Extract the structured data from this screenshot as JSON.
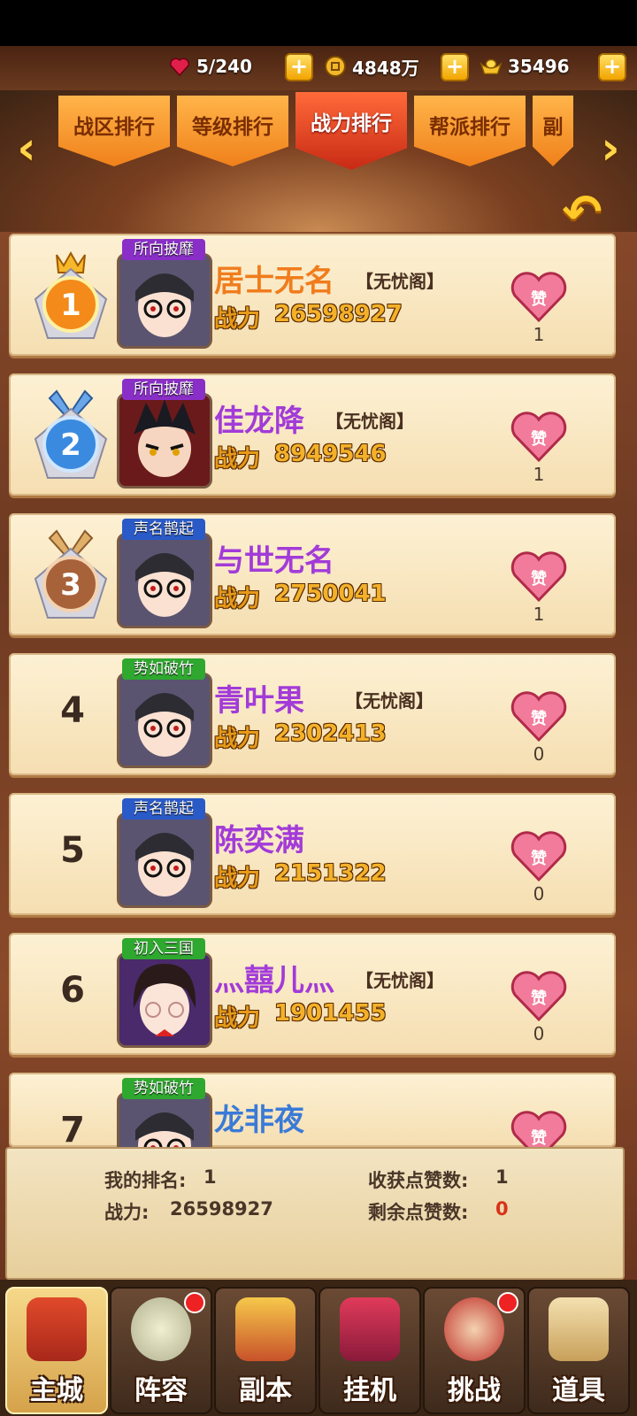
{
  "resources": {
    "stamina": "5/240",
    "coins": "4848万",
    "ingots": "35496"
  },
  "tabs": [
    {
      "label": "战区排行",
      "active": false
    },
    {
      "label": "等级排行",
      "active": false
    },
    {
      "label": "战力排行",
      "active": true
    },
    {
      "label": "帮派排行",
      "active": false
    },
    {
      "label": "副",
      "active": false
    }
  ],
  "power_label": "战力",
  "rankings": [
    {
      "rank": "1",
      "title": "所向披靡",
      "name": "居士无名",
      "guild": "【无忧阁】",
      "power": "26598927",
      "likes": "1",
      "name_color": "#f07c1c",
      "title_color": "#8a2ec8"
    },
    {
      "rank": "2",
      "title": "所向披靡",
      "name": "佳龙降",
      "guild": "【无忧阁】",
      "power": "8949546",
      "likes": "1",
      "name_color": "#a23bd8",
      "title_color": "#8a2ec8"
    },
    {
      "rank": "3",
      "title": "声名鹊起",
      "name": "与世无名",
      "guild": "",
      "power": "2750041",
      "likes": "1",
      "name_color": "#a23bd8",
      "title_color": "#2a5ac8"
    },
    {
      "rank": "4",
      "title": "势如破竹",
      "name": "青叶果",
      "guild": "【无忧阁】",
      "power": "2302413",
      "likes": "0",
      "name_color": "#a23bd8",
      "title_color": "#2fa82f"
    },
    {
      "rank": "5",
      "title": "声名鹊起",
      "name": "陈奕满",
      "guild": "",
      "power": "2151322",
      "likes": "0",
      "name_color": "#a23bd8",
      "title_color": "#2a5ac8"
    },
    {
      "rank": "6",
      "title": "初入三国",
      "name": "灬囍儿灬",
      "guild": "【无忧阁】",
      "power": "1901455",
      "likes": "0",
      "name_color": "#a23bd8",
      "title_color": "#2fa82f"
    },
    {
      "rank": "7",
      "title": "势如破竹",
      "name": "龙非夜",
      "guild": "",
      "power": "",
      "likes": "",
      "name_color": "#3a7ad8",
      "title_color": "#2fa82f"
    }
  ],
  "my_stats": {
    "my_rank_label": "我的排名:",
    "my_rank": "1",
    "my_power_label": "战力:",
    "my_power": "26598927",
    "likes_received_label": "收获点赞数:",
    "likes_received": "1",
    "likes_remaining_label": "剩余点赞数:",
    "likes_remaining": "0"
  },
  "nav": [
    {
      "label": "主城",
      "active": true
    },
    {
      "label": "阵容",
      "active": false,
      "badge": true
    },
    {
      "label": "副本",
      "active": false
    },
    {
      "label": "挂机",
      "active": false
    },
    {
      "label": "挑战",
      "active": false,
      "badge": true
    },
    {
      "label": "道具",
      "active": false
    }
  ]
}
